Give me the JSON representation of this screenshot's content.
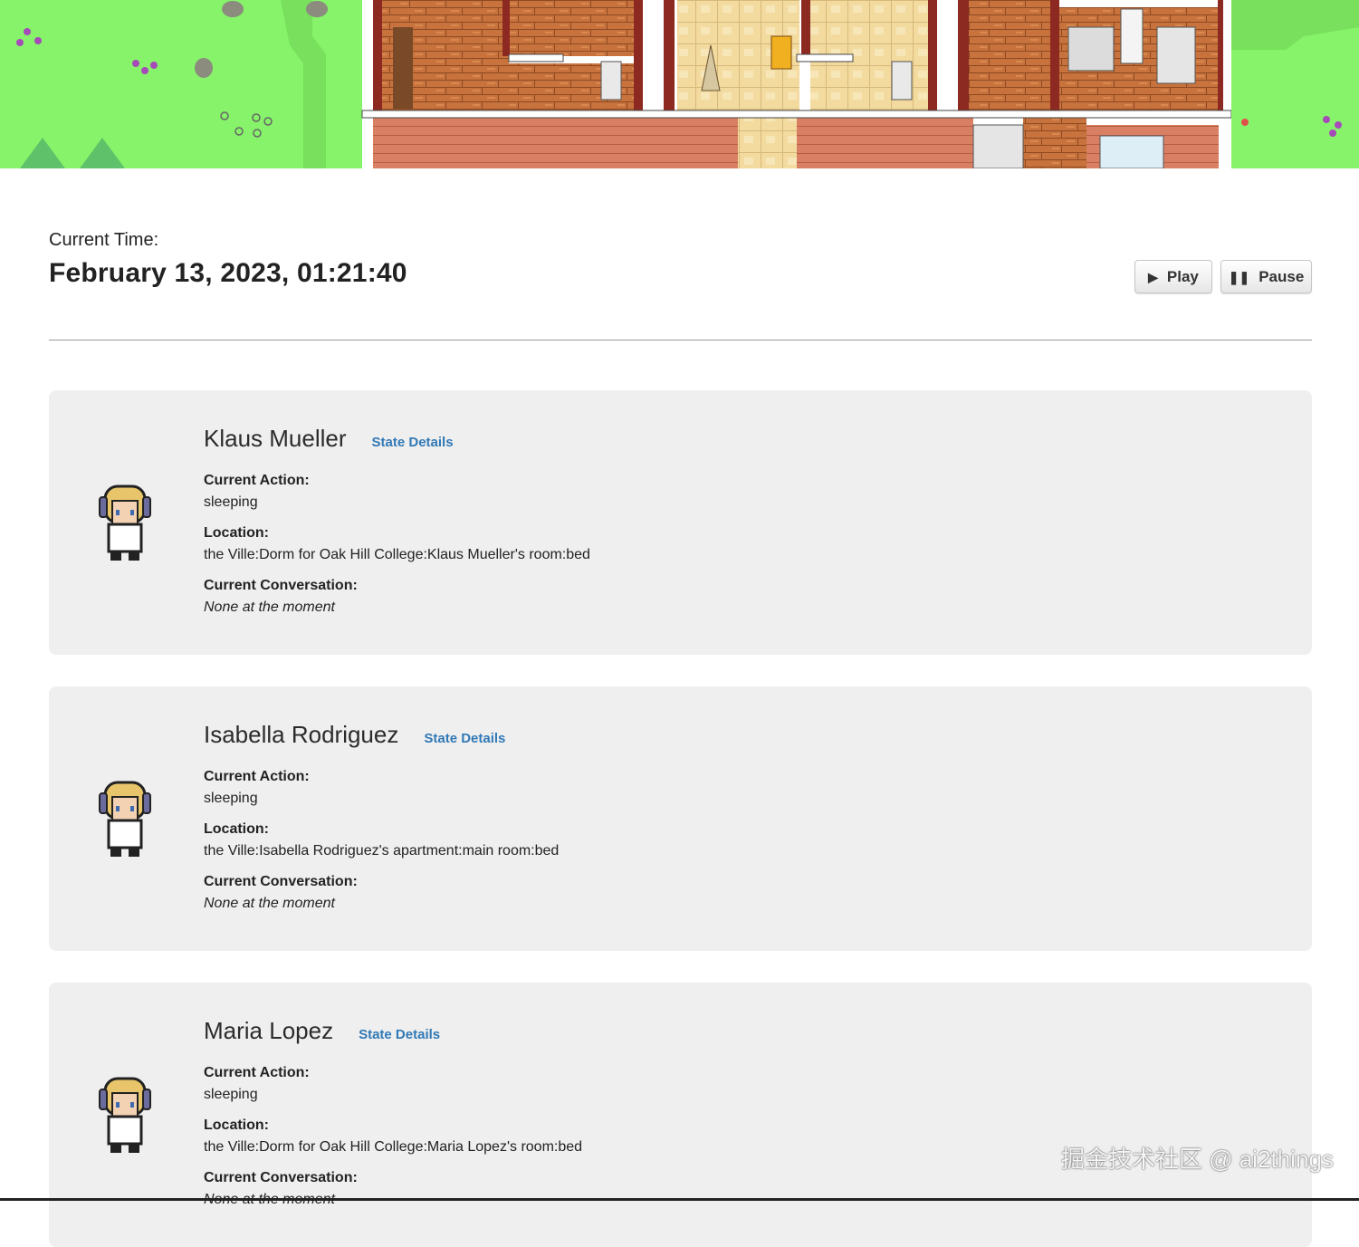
{
  "map": {
    "description_icon": "tilemap"
  },
  "header": {
    "time_label": "Current Time:",
    "time_value": "February 13, 2023, 01:21:40",
    "play_label": "Play",
    "pause_label": "Pause",
    "play_icon": "play-icon",
    "pause_icon": "pause-icon"
  },
  "labels": {
    "current_action": "Current Action:",
    "location": "Location:",
    "current_conversation": "Current Conversation:",
    "state_details": "State Details"
  },
  "personas": [
    {
      "name": "Klaus Mueller",
      "action": "sleeping",
      "location": "the Ville:Dorm for Oak Hill College:Klaus Mueller's room:bed",
      "conversation": "None at the moment"
    },
    {
      "name": "Isabella Rodriguez",
      "action": "sleeping",
      "location": "the Ville:Isabella Rodriguez's apartment:main room:bed",
      "conversation": "None at the moment"
    },
    {
      "name": "Maria Lopez",
      "action": "sleeping",
      "location": "the Ville:Dorm for Oak Hill College:Maria Lopez's room:bed",
      "conversation": "None at the moment"
    }
  ],
  "watermark": "掘金技术社区 @ ai2things",
  "colors": {
    "link": "#3179b6",
    "card_bg": "#efefef",
    "grass": "#86f36a",
    "floor": "#c8733d"
  }
}
